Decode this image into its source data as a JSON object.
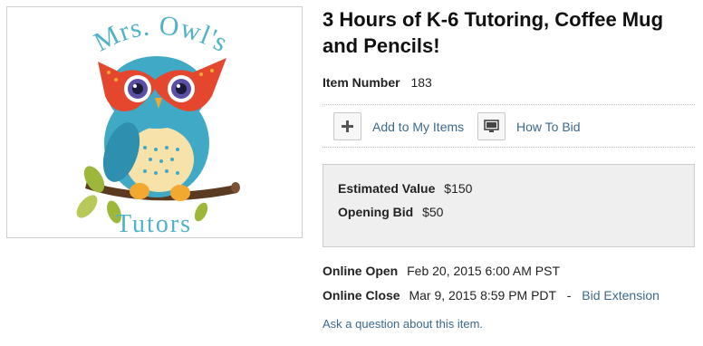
{
  "logo": {
    "text_top": "Mrs. Owl's",
    "text_bottom": "Tutors",
    "colors": {
      "teal": "#4fb3c8",
      "owl_body": "#3fa9c6",
      "mask": "#e5472e",
      "belly": "#f7e3a9",
      "branch": "#5b3a22",
      "leaf": "#9db73a",
      "feet": "#f3a92f"
    }
  },
  "item": {
    "title": "3 Hours of K-6 Tutoring, Coffee Mug and Pencils!",
    "number_label": "Item Number",
    "number": "183"
  },
  "actions": {
    "add_label": "Add to My Items",
    "add_icon": "plus-icon",
    "howto_label": "How To Bid",
    "howto_icon": "monitor-icon"
  },
  "values": {
    "estimated_label": "Estimated Value",
    "estimated": "$150",
    "opening_label": "Opening Bid",
    "opening": "$50"
  },
  "schedule": {
    "open_label": "Online Open",
    "open": "Feb 20, 2015 6:00 AM PST",
    "close_label": "Online Close",
    "close": "Mar 9, 2015 8:59 PM PDT",
    "separator": "-",
    "extension_label": "Bid Extension"
  },
  "ask_label": "Ask a question about this item.",
  "colors": {
    "link": "#3b6a8d",
    "box_bg": "#efefef",
    "border": "#cdcdcd"
  }
}
